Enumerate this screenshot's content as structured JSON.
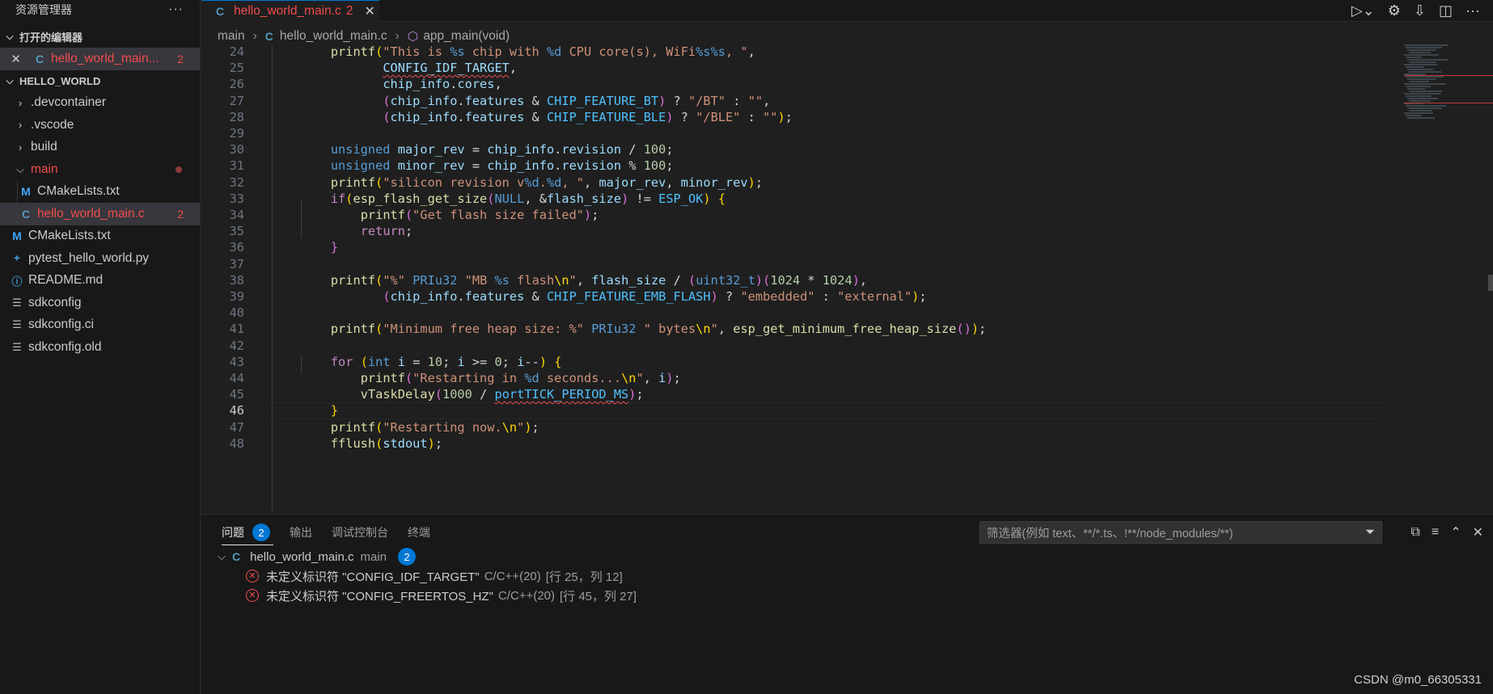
{
  "sidebar": {
    "title": "资源管理器",
    "more": "···",
    "open_editors": {
      "section": "打开的编辑器",
      "items": [
        {
          "name": "hello_world_main...",
          "badge": "2"
        }
      ]
    },
    "workspace": {
      "section": "HELLO_WORLD",
      "folders": [
        ".devcontainer",
        ".vscode",
        "build"
      ],
      "main_folder": "main",
      "main_children": [
        {
          "name": "CMakeLists.txt",
          "icon": "M"
        },
        {
          "name": "hello_world_main.c",
          "icon": "C",
          "badge": "2"
        }
      ],
      "files": [
        {
          "name": "CMakeLists.txt",
          "icon": "M"
        },
        {
          "name": "pytest_hello_world.py",
          "icon": "python"
        },
        {
          "name": "README.md",
          "icon": "info"
        },
        {
          "name": "sdkconfig",
          "icon": "lines"
        },
        {
          "name": "sdkconfig.ci",
          "icon": "lines"
        },
        {
          "name": "sdkconfig.old",
          "icon": "lines"
        }
      ]
    }
  },
  "tab": {
    "name": "hello_world_main.c",
    "badge": "2",
    "close": "✕"
  },
  "breadcrumb": {
    "folder": "main",
    "file": "hello_world_main.c",
    "symbol": "app_main(void)"
  },
  "editor": {
    "active_line": 46,
    "line_numbers": [
      "24",
      "25",
      "26",
      "27",
      "28",
      "29",
      "30",
      "31",
      "32",
      "33",
      "34",
      "35",
      "36",
      "37",
      "38",
      "39",
      "40",
      "41",
      "42",
      "43",
      "44",
      "45",
      "46",
      "47",
      "48"
    ]
  },
  "panel": {
    "tabs": [
      "问题",
      "输出",
      "调试控制台",
      "终端"
    ],
    "problem_count": "2",
    "filter_placeholder": "筛选器(例如 text、**/*.ts、!**/node_modules/**)",
    "group": {
      "file": "hello_world_main.c",
      "folder": "main",
      "count": "2"
    },
    "errors": [
      {
        "message": "未定义标识符 \"CONFIG_IDF_TARGET\"",
        "source": "C/C++(20)",
        "location": "[行 25，列 12]"
      },
      {
        "message": "未定义标识符 \"CONFIG_FREERTOS_HZ\"",
        "source": "C/C++(20)",
        "location": "[行 45，列 27]"
      }
    ]
  },
  "watermark": "CSDN @m0_66305331"
}
